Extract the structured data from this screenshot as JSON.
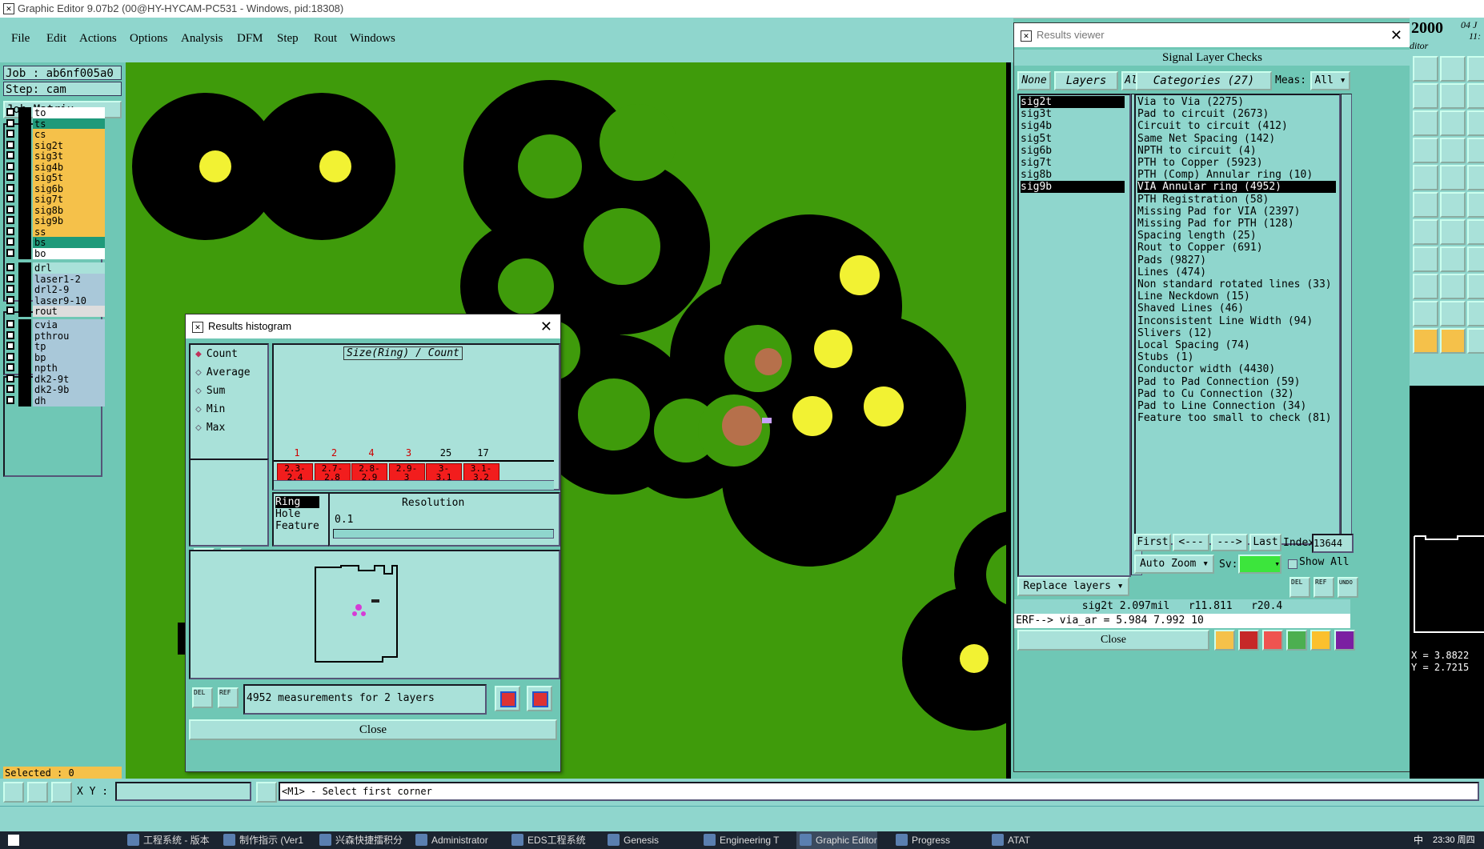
{
  "titlebar": {
    "title": "Graphic Editor 9.07b2 (00@HY-HYCAM-PC531 - Windows, pid:18308)"
  },
  "menu": {
    "items": [
      "File",
      "Edit",
      "Actions",
      "Options",
      "Analysis",
      "DFM",
      "Step",
      "Rout",
      "Windows"
    ]
  },
  "left": {
    "job": "Job : ab6nf005a0",
    "step": "Step: cam",
    "job_matrix": "Job Matrix ...",
    "layers_a": [
      {
        "name": "to",
        "color": "#ffffff"
      },
      {
        "name": "ts",
        "color": "#1f9a7a"
      },
      {
        "name": "cs",
        "color": "#f5c14a"
      },
      {
        "name": "sig2t",
        "color": "#f5c14a"
      },
      {
        "name": "sig3t",
        "color": "#f5c14a"
      },
      {
        "name": "sig4b",
        "color": "#f5c14a"
      },
      {
        "name": "sig5t",
        "color": "#f5c14a"
      },
      {
        "name": "sig6b",
        "color": "#f5c14a"
      },
      {
        "name": "sig7t",
        "color": "#f5c14a"
      },
      {
        "name": "sig8b",
        "color": "#f5c14a"
      },
      {
        "name": "sig9b",
        "color": "#f5c14a"
      },
      {
        "name": "ss",
        "color": "#f5c14a"
      },
      {
        "name": "bs",
        "color": "#1f9a7a"
      },
      {
        "name": "bo",
        "color": "#ffffff"
      }
    ],
    "layers_b": [
      {
        "name": "drl",
        "color": "#a9e1d9"
      },
      {
        "name": "laser1-2",
        "color": "#a9c8d9"
      },
      {
        "name": "drl2-9",
        "color": "#a9c8d9"
      },
      {
        "name": "laser9-10",
        "color": "#a9c8d9"
      },
      {
        "name": "rout",
        "color": "#dddddd"
      }
    ],
    "layers_c": [
      {
        "name": "cvia",
        "color": "#a9c8d9"
      },
      {
        "name": "pthrou",
        "color": "#a9c8d9"
      },
      {
        "name": "tp",
        "color": "#a9c8d9"
      },
      {
        "name": "bp",
        "color": "#a9c8d9"
      },
      {
        "name": "npth",
        "color": "#a9c8d9"
      },
      {
        "name": "dk2-9t",
        "color": "#a9c8d9"
      },
      {
        "name": "dk2-9b",
        "color": "#a9c8d9"
      },
      {
        "name": "dh",
        "color": "#a9c8d9"
      }
    ],
    "selected": "Selected : 0"
  },
  "histogram": {
    "title": "Results histogram",
    "options": [
      "Count",
      "Average",
      "Sum",
      "Min",
      "Max"
    ],
    "chart_title": "Size(Ring) / Count",
    "counts": [
      "1",
      "2",
      "4",
      "3",
      "25",
      "17"
    ],
    "bins": [
      [
        "2.3-",
        "2.4"
      ],
      [
        "2.7-",
        "2.8"
      ],
      [
        "2.8-",
        "2.9"
      ],
      [
        "2.9-",
        "3"
      ],
      [
        "3-",
        "3.1"
      ],
      [
        "3.1-",
        "3.2"
      ]
    ],
    "types": [
      "Ring",
      "Hole",
      "Feature"
    ],
    "resolution_label": "Resolution",
    "resolution_value": "0.1",
    "measurements": "4952 measurements for 2 layers",
    "close": "Close",
    "del": "DEL",
    "ref": "REF"
  },
  "results": {
    "title": "Results viewer",
    "header": "Signal Layer Checks",
    "none": "None",
    "layers": "Layers",
    "all": "All",
    "categories": "Categories (27)",
    "meas_label": "Meas:",
    "meas_value": "All",
    "layer_list": [
      "sig2t",
      "sig3t",
      "sig4b",
      "sig5t",
      "sig6b",
      "sig7t",
      "sig8b",
      "sig9b"
    ],
    "category_list": [
      "Via to Via (2275)",
      "Pad to circuit (2673)",
      "Circuit to circuit (412)",
      "Same Net Spacing (142)",
      "NPTH to circuit (4)",
      "PTH to Copper (5923)",
      "PTH (Comp) Annular ring (10)",
      "VIA Annular ring (4952)",
      "PTH Registration (58)",
      "Missing Pad for VIA (2397)",
      "Missing Pad for PTH (128)",
      "Spacing length (25)",
      "Rout to Copper (691)",
      "Pads (9827)",
      "Lines (474)",
      "Non standard rotated lines (33)",
      "Line Neckdown (15)",
      "Shaved Lines (46)",
      "Inconsistent Line Width (94)",
      "Slivers (12)",
      "Local Spacing (74)",
      "Stubs (1)",
      "Conductor width (4430)",
      "Pad to Pad Connection (59)",
      "Pad to Cu Connection (32)",
      "Pad to Line Connection (34)",
      "Feature too small to check (81)"
    ],
    "nav": {
      "first": "First",
      "prev": "<---",
      "next": "--->",
      "last": "Last",
      "index_label": "Index:",
      "index_value": "13644"
    },
    "auto_zoom": "Auto Zoom",
    "sv": "Sv:",
    "show_all": "Show All",
    "replace_layers": "Replace layers",
    "info": "sig2t 2.097mil   r11.811   r20.4",
    "erf": "ERF--> via_ar = 5.984 7.992 10",
    "close": "Close",
    "del": "DEL",
    "ref": "REF",
    "undo": "UNDO"
  },
  "rightside": {
    "number": "2000",
    "date": "04 J",
    "time": "11:",
    "editor": "ditor",
    "x": "X = 3.8822",
    "y": "Y = 2.7215"
  },
  "status": {
    "xy_label": "X Y :",
    "prompt": "<M1> - Select first corner"
  },
  "taskbar": {
    "items": [
      "工程系统 - 版本",
      "制作指示 (Ver1",
      "兴森快捷擂积分",
      "Administrator",
      "EDS工程系统",
      "Genesis",
      "Engineering T",
      "Graphic Editor",
      "Progress",
      "ATAT"
    ],
    "ime": "中",
    "clock": "23:30 周四"
  }
}
